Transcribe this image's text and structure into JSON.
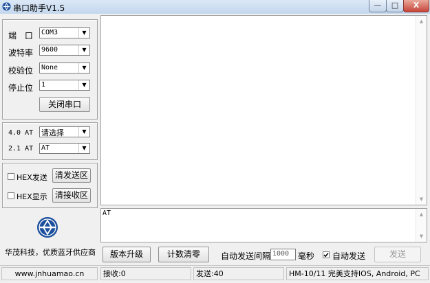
{
  "window": {
    "title": "串口助手V1.5",
    "min_icon": "minimize-icon",
    "max_icon": "maximize-icon",
    "close_icon": "close-icon",
    "min_glyph": "—",
    "max_glyph": "□",
    "close_glyph": "X"
  },
  "serial": {
    "port_label": "端 口",
    "port_value": "COM3",
    "baud_label": "波特率",
    "baud_value": "9600",
    "parity_label": "校验位",
    "parity_value": "None",
    "stop_label": "停止位",
    "stop_value": "1",
    "close_button": "关闭串口"
  },
  "at": {
    "at40_label": "4.0 AT",
    "at40_value": "请选择",
    "at21_label": "2.1 AT",
    "at21_value": "AT"
  },
  "hex": {
    "hex_send_label": "HEX发送",
    "clear_send_button": "清发送区",
    "hex_show_label": "HEX显示",
    "clear_recv_button": "清接收区"
  },
  "company": {
    "slogan": "华茂科技，优质蓝牙供应商",
    "website": "www.jnhuamao.cn"
  },
  "send_area": {
    "text": "AT"
  },
  "bottom": {
    "upgrade_button": "版本升级",
    "clear_count_button": "计数清零",
    "auto_interval_label": "自动发送间隔",
    "interval_value": "1000",
    "ms_label": "毫秒",
    "auto_send_label": "自动发送",
    "auto_send_checked": true,
    "send_button": "发送"
  },
  "status": {
    "recv": "接收:0",
    "sent": "发送:40",
    "support": "HM-10/11 完美支持IOS, Android, PC"
  },
  "colors": {
    "accent": "#1c4f9c",
    "title_bg": "#c4d7ee",
    "close_red": "#c7443a"
  }
}
